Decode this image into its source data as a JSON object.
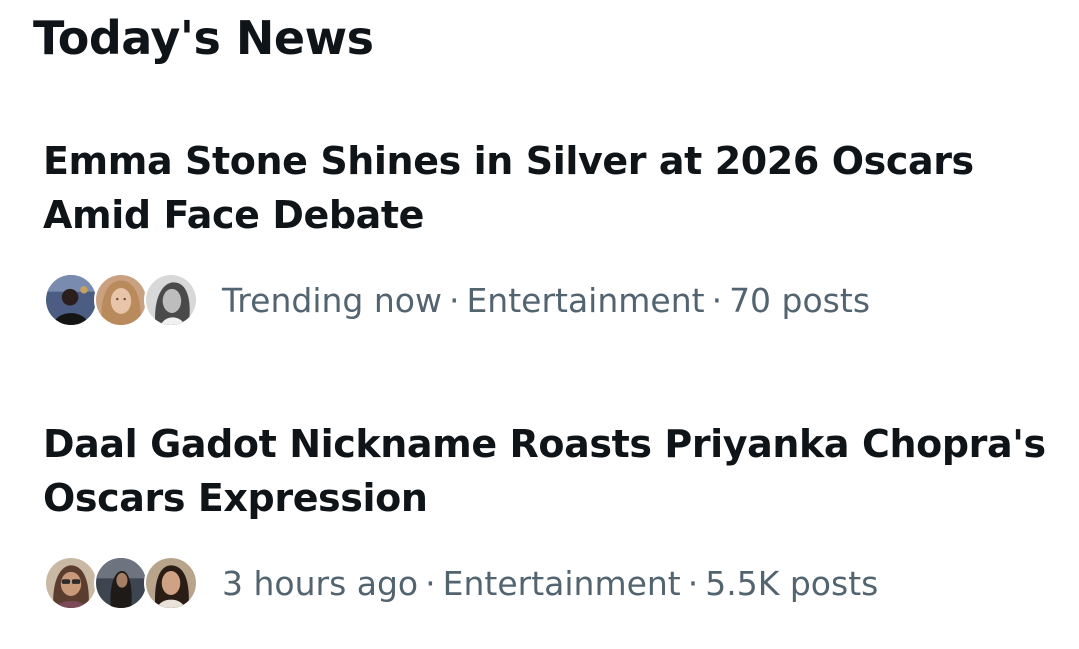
{
  "section": {
    "title": "Today's News"
  },
  "items": [
    {
      "headline_line1": "Emma Stone Shines in Silver at 2026 Oscars",
      "headline_line2": "Amid Face Debate",
      "time": "Trending now",
      "category": "Entertainment",
      "posts": "70 posts",
      "avatars": [
        "avatar-photo-icon",
        "avatar-photo-icon",
        "avatar-photo-icon"
      ]
    },
    {
      "headline_line1": "Daal Gadot Nickname Roasts Priyanka Chopra's",
      "headline_line2": "Oscars Expression",
      "time": "3 hours ago",
      "category": "Entertainment",
      "posts": "5.5K posts",
      "avatars": [
        "avatar-photo-icon",
        "avatar-photo-icon",
        "avatar-photo-icon"
      ]
    }
  ],
  "colors": {
    "text_primary": "#0f1419",
    "text_secondary": "#536471",
    "background": "#ffffff"
  }
}
